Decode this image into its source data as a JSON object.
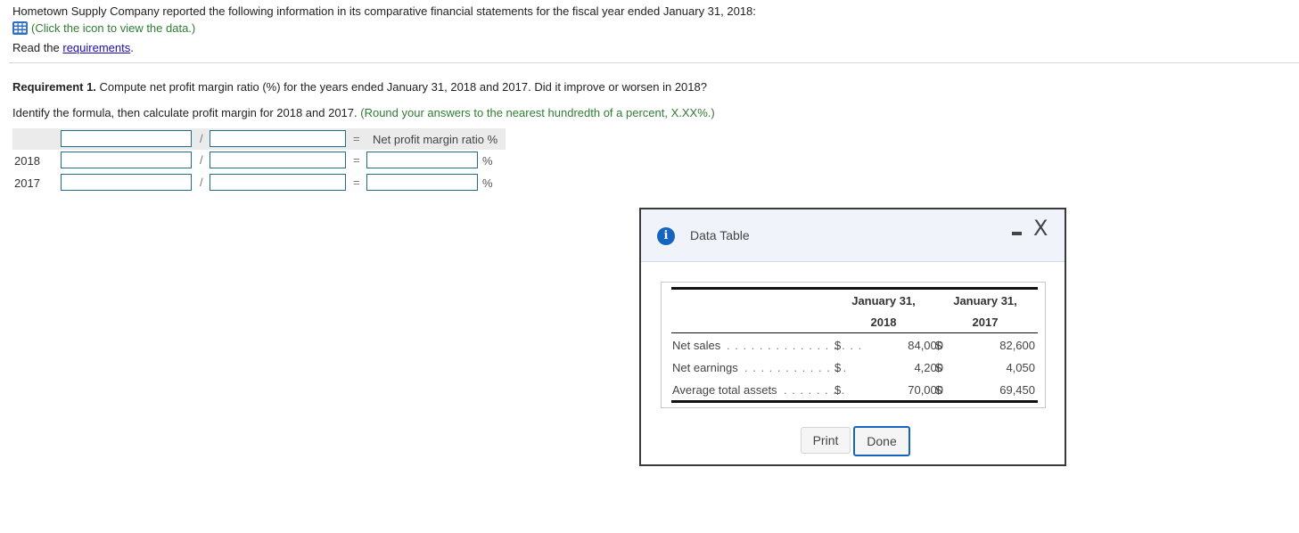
{
  "intro": {
    "text": "Hometown Supply Company reported the following information in its comparative financial statements for the fiscal year ended January 31, 2018:",
    "click_icon_text": "(Click the icon to view the data.)",
    "icon": "table-grid-icon",
    "read_prefix": "Read the ",
    "requirements_link": "requirements",
    "read_suffix": "."
  },
  "requirement": {
    "label": "Requirement 1.",
    "text": " Compute net profit margin ratio (%) for the years ended January 31, 2018 and 2017. Did it improve or worsen in 2018?",
    "identify_text": "Identify the formula, then calculate profit margin for 2018 and 2017. ",
    "round_hint": "(Round your answers to the nearest hundredth of a percent, X.XX%.)"
  },
  "formula": {
    "slash": "/",
    "equals": "=",
    "result_header": "Net profit margin ratio %",
    "percent": "%",
    "rows": [
      {
        "label": "",
        "numerator": "",
        "denominator": ""
      },
      {
        "label": "2018",
        "numerator": "",
        "denominator": "",
        "result": ""
      },
      {
        "label": "2017",
        "numerator": "",
        "denominator": "",
        "result": ""
      }
    ]
  },
  "modal": {
    "title": "Data Table",
    "info_icon": "i",
    "close_glyph": "X",
    "table": {
      "col_headers": [
        {
          "line1": "January 31,",
          "line2": "2018"
        },
        {
          "line1": "January 31,",
          "line2": "2017"
        }
      ],
      "currency": "$",
      "rows": [
        {
          "label": "Net sales",
          "dots": ". . . . . . . . . . . . . . . . .",
          "v2018": "84,000",
          "v2017": "82,600"
        },
        {
          "label": "Net earnings",
          "dots": ". . . . . . . . . . . . .",
          "v2018": "4,200",
          "v2017": "4,050"
        },
        {
          "label": "Average total assets",
          "dots": ". . . . . . . .",
          "v2018": "70,000",
          "v2017": "69,450"
        }
      ]
    },
    "print_label": "Print",
    "done_label": "Done"
  }
}
